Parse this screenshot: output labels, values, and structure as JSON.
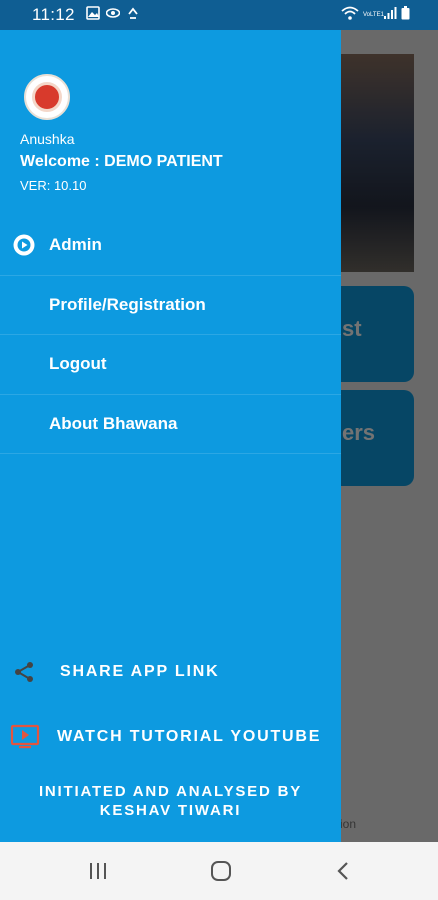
{
  "status_bar": {
    "time": "11:12",
    "left_icons": [
      "image-icon",
      "eye-icon",
      "sync-icon"
    ],
    "right_icons": [
      "wifi-icon",
      "volte-icon",
      "signal-icon",
      "battery-icon"
    ],
    "volte_label": "VoLTE1"
  },
  "drawer": {
    "user_name": "Anushka",
    "welcome": "Welcome : DEMO PATIENT",
    "version": "VER: 10.10",
    "menu": [
      {
        "label": "Admin",
        "icon": "play-circle-icon"
      },
      {
        "label": "Profile/Registration"
      },
      {
        "label": "Logout"
      },
      {
        "label": "About Bhawana"
      }
    ],
    "share_label": "SHARE APP LINK",
    "tutorial_label": "WATCH TUTORIAL YOUTUBE",
    "initiated_line1": "INITIATED AND ANALYSED BY",
    "initiated_line2": "KESHAV TIWARI",
    "accent_color": "#0d9ae0",
    "tutorial_icon_color": "#e2553f"
  },
  "background_app": {
    "card1_fragment": "st",
    "card2_fragment": "ers",
    "footer_fragment": "ion"
  },
  "nav_bar": {
    "buttons": [
      "recent-apps-icon",
      "home-icon",
      "back-icon"
    ]
  }
}
